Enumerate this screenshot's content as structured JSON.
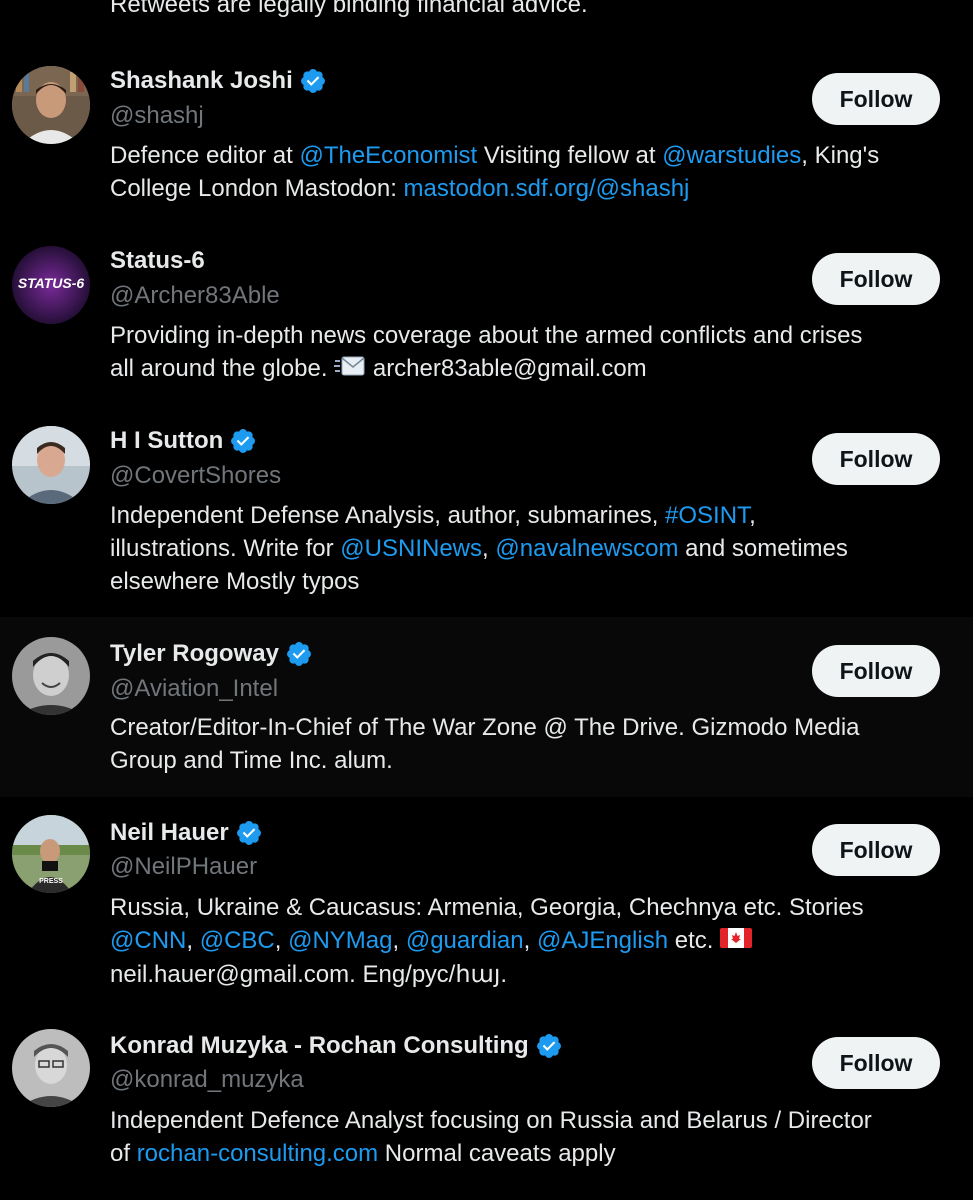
{
  "top_bio": "Retweets are legally binding financial advice.",
  "follow_label": "Follow",
  "accounts": [
    {
      "name": "Shashank Joshi",
      "handle": "@shashj",
      "verified": true,
      "bio": [
        [
          "Defence editor at ",
          "@TheEconomist",
          " Visiting fellow at ",
          "@warstudies",
          ", King's"
        ],
        [
          "College London Mastodon: ",
          "mastodon.sdf.org/@shashj"
        ]
      ]
    },
    {
      "name": "Status-6",
      "handle": "@Archer83Able",
      "verified": false,
      "avatar_text": "STATUS-6",
      "bio": [
        [
          "Providing in-depth news coverage about the armed conflicts and crises"
        ],
        [
          "all around the globe. ",
          "archer83able@gmail.com"
        ]
      ]
    },
    {
      "name": "H I Sutton",
      "handle": "@CovertShores",
      "verified": true,
      "bio": [
        [
          "Independent Defense Analysis, author, submarines, ",
          "#OSINT",
          ","
        ],
        [
          "illustrations. Write for ",
          "@USNINews",
          ", ",
          "@navalnewscom",
          " and sometimes"
        ],
        [
          "elsewhere Mostly typos"
        ]
      ]
    },
    {
      "name": "Tyler Rogoway",
      "handle": "@Aviation_Intel",
      "verified": true,
      "bio": [
        [
          "Creator/Editor-In-Chief of The War Zone @ The Drive. Gizmodo Media"
        ],
        [
          "Group and Time Inc. alum."
        ]
      ]
    },
    {
      "name": "Neil Hauer",
      "handle": "@NeilPHauer",
      "verified": true,
      "avatar_text": "PRESS",
      "bio": [
        [
          "Russia, Ukraine & Caucasus: Armenia, Georgia, Chechnya etc. Stories"
        ],
        [
          "@CNN",
          ", ",
          "@CBC",
          ", ",
          "@NYMag",
          ", ",
          "@guardian",
          ", ",
          "@AJEnglish",
          " etc. "
        ],
        [
          "neil.hauer@gmail.com. Eng/рус/հայ."
        ]
      ]
    },
    {
      "name": "Konrad Muzyka - Rochan Consulting",
      "handle": "@konrad_muzyka",
      "verified": true,
      "bio": [
        [
          "Independent Defence Analyst focusing on Russia and Belarus / Director"
        ],
        [
          "of ",
          "rochan-consulting.com",
          " Normal caveats apply"
        ]
      ]
    }
  ],
  "colors": {
    "background": "#000000",
    "hover_row": "#080808",
    "text": "#e7e9ea",
    "muted": "#71767b",
    "link": "#1d9bf0",
    "verified": "#1d9bf0",
    "button_bg": "#eff3f4",
    "button_text": "#0f1419"
  }
}
